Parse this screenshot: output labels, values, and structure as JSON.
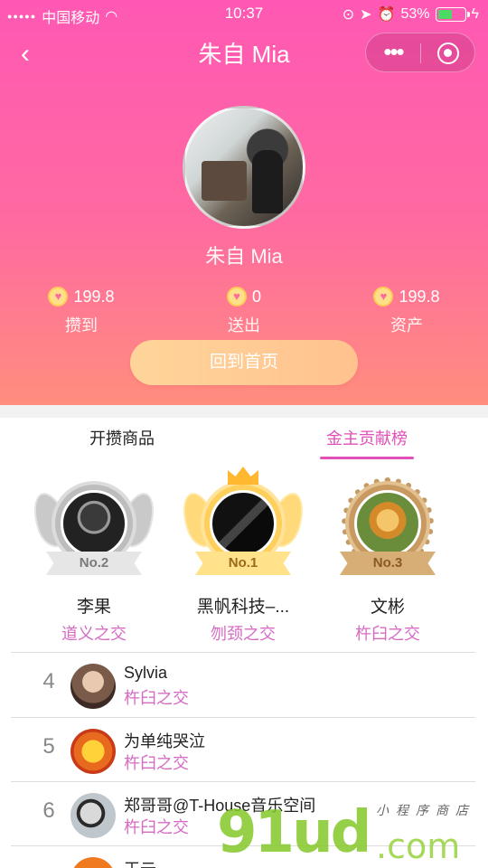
{
  "status_bar": {
    "carrier": "中国移动",
    "time": "10:37",
    "battery": "53%"
  },
  "nav": {
    "title": "朱自 Mia",
    "more_icon": "•••"
  },
  "profile": {
    "name": "朱自 Mia",
    "stats": [
      {
        "value": "199.8",
        "label": "攒到"
      },
      {
        "value": "0",
        "label": "送出"
      },
      {
        "value": "199.8",
        "label": "资产"
      }
    ],
    "home_button": "回到首页"
  },
  "tabs": [
    {
      "label": "开攒商品",
      "active": false
    },
    {
      "label": "金主贡献榜",
      "active": true
    }
  ],
  "podium": [
    {
      "badge": "No.2",
      "name": "李果",
      "relation": "道义之交",
      "medal": "silver"
    },
    {
      "badge": "No.1",
      "name": "黑帆科技–...",
      "relation": "刎颈之交",
      "medal": "gold"
    },
    {
      "badge": "No.3",
      "name": "文彬",
      "relation": "杵臼之交",
      "medal": "bronze"
    }
  ],
  "ranking": [
    {
      "rank": "4",
      "name": "Sylvia",
      "relation": "杵臼之交"
    },
    {
      "rank": "5",
      "name": "为单纯哭泣",
      "relation": "杵臼之交"
    },
    {
      "rank": "6",
      "name": "郑哥哥@T-House音乐空间",
      "relation": "杵臼之交"
    },
    {
      "rank": "",
      "name": "王云",
      "relation": ""
    }
  ],
  "watermark": {
    "big": "91ud",
    "com": ".com",
    "small": "小程序商店"
  },
  "colors": {
    "header_top": "#ff58b4",
    "header_bottom": "#ff8e7e",
    "accent": "#e050b8",
    "relation": "#d66bc2"
  }
}
